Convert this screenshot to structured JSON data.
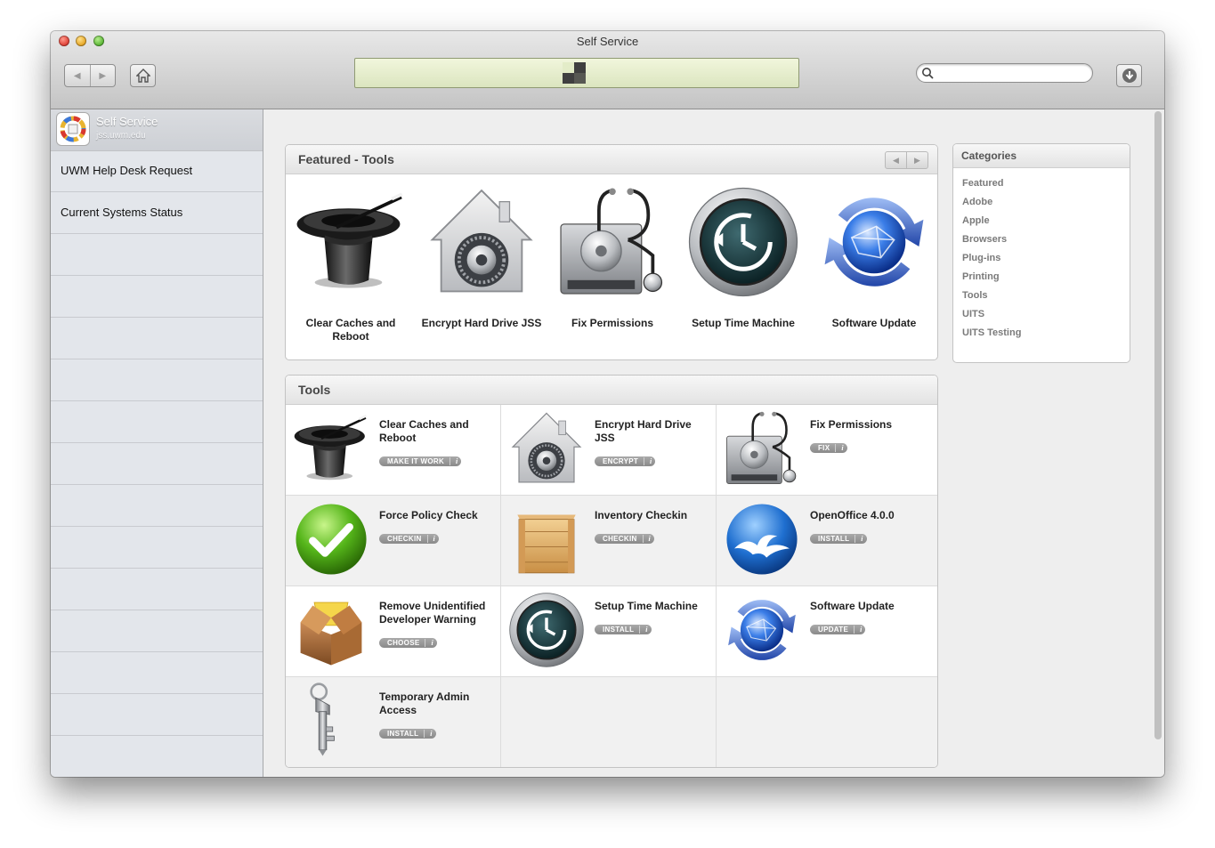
{
  "window": {
    "title": "Self Service"
  },
  "toolbar": {
    "back_label": "◀",
    "forward_label": "▶",
    "search_placeholder": ""
  },
  "sidebar": {
    "app_name": "Self Service",
    "host": "jss.uwm.edu",
    "items": [
      {
        "label": "UWM Help Desk Request"
      },
      {
        "label": "Current Systems Status"
      }
    ]
  },
  "featured": {
    "title": "Featured - Tools",
    "items": [
      {
        "label": "Clear Caches and Reboot",
        "icon": "magic-hat-icon"
      },
      {
        "label": "Encrypt Hard Drive JSS",
        "icon": "filevault-icon"
      },
      {
        "label": "Fix Permissions",
        "icon": "disk-utility-icon"
      },
      {
        "label": "Setup Time Machine",
        "icon": "time-machine-icon"
      },
      {
        "label": "Software Update",
        "icon": "software-update-icon"
      }
    ]
  },
  "tools": {
    "title": "Tools",
    "items": [
      {
        "name": "Clear Caches and Reboot",
        "action": "MAKE IT WORK",
        "icon": "magic-hat-icon"
      },
      {
        "name": "Encrypt Hard Drive JSS",
        "action": "ENCRYPT",
        "icon": "filevault-icon"
      },
      {
        "name": "Fix Permissions",
        "action": "FIX",
        "icon": "disk-utility-icon"
      },
      {
        "name": "Force Policy Check",
        "action": "CHECKIN",
        "icon": "green-check-icon"
      },
      {
        "name": "Inventory Checkin",
        "action": "CHECKIN",
        "icon": "crate-icon"
      },
      {
        "name": "OpenOffice 4.0.0",
        "action": "INSTALL",
        "icon": "openoffice-icon"
      },
      {
        "name": "Remove Unidentified Developer Warning",
        "action": "CHOOSE",
        "icon": "package-icon"
      },
      {
        "name": "Setup Time Machine",
        "action": "INSTALL",
        "icon": "time-machine-icon"
      },
      {
        "name": "Software Update",
        "action": "UPDATE",
        "icon": "software-update-icon"
      },
      {
        "name": "Temporary Admin Access",
        "action": "INSTALL",
        "icon": "key-icon"
      }
    ],
    "info_glyph": "i"
  },
  "categories": {
    "title": "Categories",
    "items": [
      "Featured",
      "Adobe",
      "Apple",
      "Browsers",
      "Plug-ins",
      "Printing",
      "Tools",
      "UITS",
      "UITS Testing"
    ]
  },
  "colors": {
    "lcd": "#e3ecc8",
    "sidebar": "#e3e6eb",
    "pill": "#9a9a9a",
    "accent_blue": "#2f63c8"
  }
}
